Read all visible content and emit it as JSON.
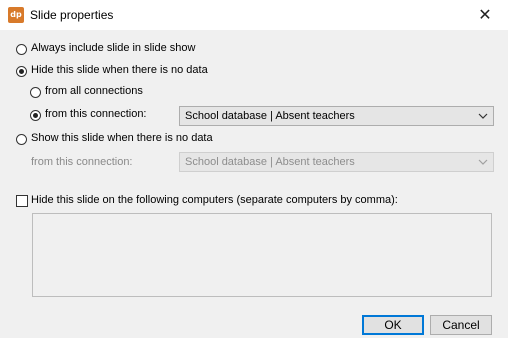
{
  "window": {
    "title": "Slide properties",
    "app_icon_text": "dp",
    "close_glyph": "✕",
    "app_icon_color": "#d87a2a"
  },
  "options": {
    "always_include": {
      "label": "Always include slide in slide show",
      "checked": false
    },
    "hide_no_data": {
      "label": "Hide this slide when there is no data",
      "checked": true
    },
    "hide_from_all": {
      "label": "from all connections",
      "checked": false
    },
    "hide_from_this": {
      "label": "from this connection:",
      "checked": true
    },
    "hide_connection_value": "School database | Absent teachers",
    "show_no_data": {
      "label": "Show this slide when there is no data",
      "checked": false
    },
    "show_from_this_label": "from this connection:",
    "show_connection_value": "School database | Absent teachers"
  },
  "computers": {
    "label": "Hide this slide on the following computers (separate computers by comma):",
    "checked": false,
    "value": ""
  },
  "buttons": {
    "ok": "OK",
    "cancel": "Cancel"
  },
  "colors": {
    "primary_button_border": "#0078d7",
    "disabled_text": "#8a8a8a"
  }
}
